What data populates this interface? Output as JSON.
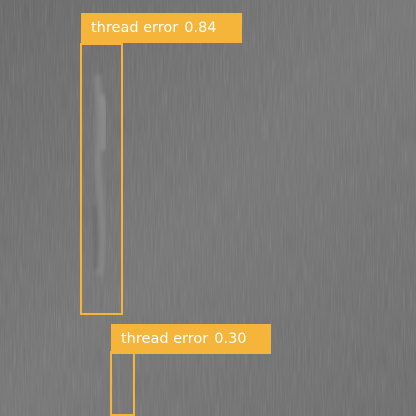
{
  "detections": [
    {
      "label": "thread error",
      "confidence": "0.84"
    },
    {
      "label": "thread error",
      "confidence": "0.30"
    }
  ],
  "colors": {
    "box": "#f5b43a",
    "label_text": "#ffffff",
    "fabric_base": "#707070"
  }
}
